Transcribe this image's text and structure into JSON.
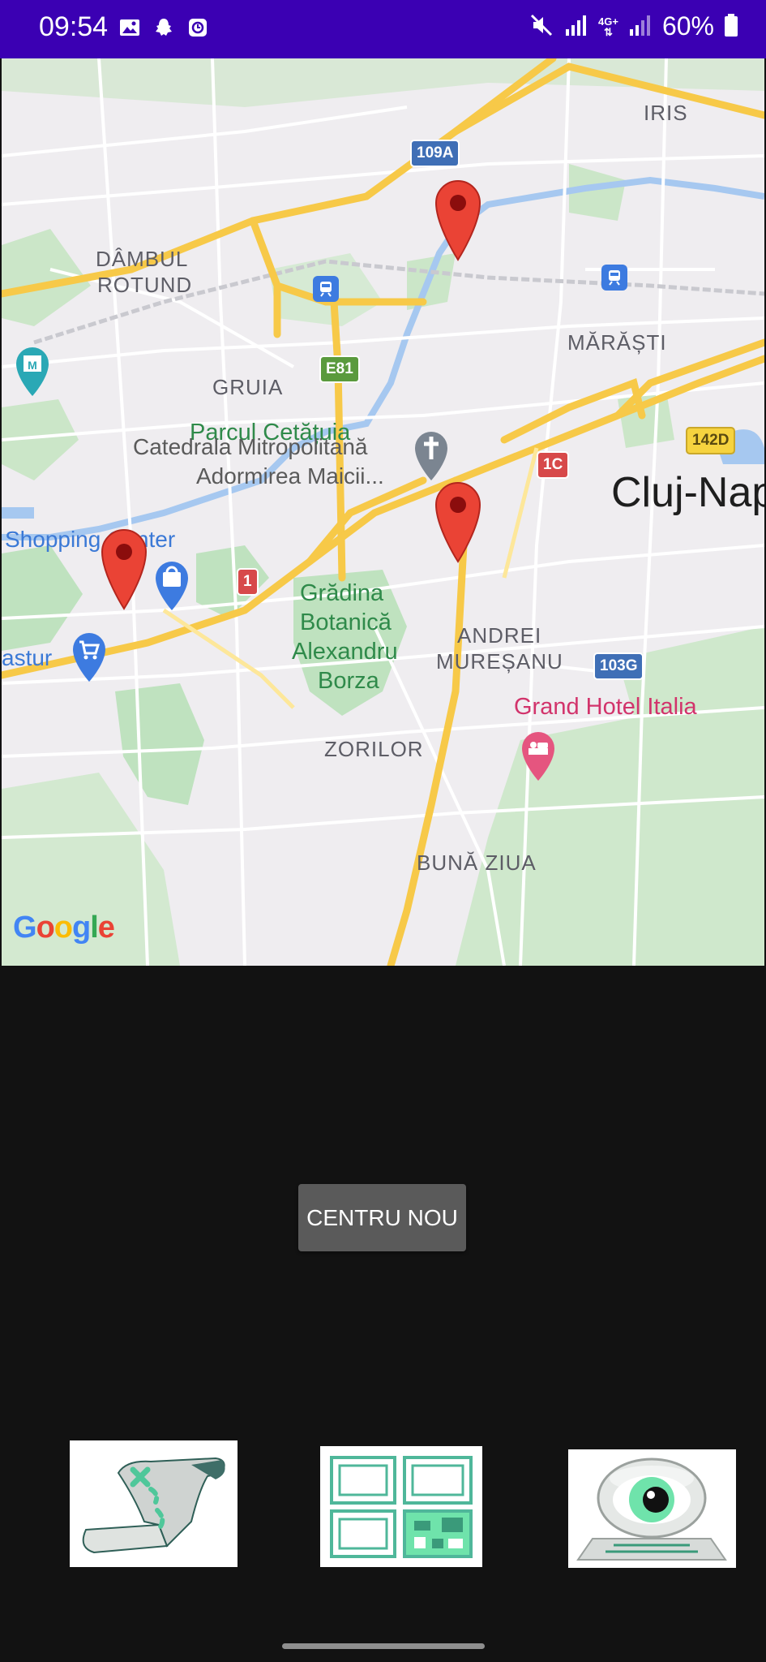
{
  "status_bar": {
    "time": "09:54",
    "battery": "60%",
    "network": "4G+",
    "bg_color": "#3b00b3"
  },
  "map": {
    "labels": {
      "iris": "IRIS",
      "dambul_1": "DÂMBUL",
      "dambul_2": "ROTUND",
      "marasti": "MĂRĂȘTI",
      "gruia": "GRUIA",
      "parcul": "Parcul Cetățuia",
      "catedrala_1": "Catedrala Mitropolitană",
      "catedrala_2": "Adormirea Maicii...",
      "city": "Cluj-Nap",
      "shopping": "Shopping Center",
      "gradina_1": "Grădina",
      "gradina_2": "Botanică",
      "gradina_3": "Alexandru",
      "gradina_4": "Borza",
      "andrei_1": "ANDREI",
      "andrei_2": "MUREȘANU",
      "grand_hotel": "Grand Hotel Italia",
      "astur": "astur",
      "zorilor": "ZORILOR",
      "buna_ziua": "BUNĂ ZIUA"
    },
    "shields": {
      "r109a": "109A",
      "e81": "E81",
      "r142d": "142D",
      "r1c": "1C",
      "r1": "1",
      "r103g": "103G"
    },
    "attribution": "Google",
    "marker_color": "#ea4335"
  },
  "actions": {
    "center_button": "CENTRU NOU"
  },
  "bottom_nav": [
    {
      "icon": "map-scroll-icon"
    },
    {
      "icon": "dashboard-grid-icon"
    },
    {
      "icon": "eye-scanner-icon"
    }
  ]
}
